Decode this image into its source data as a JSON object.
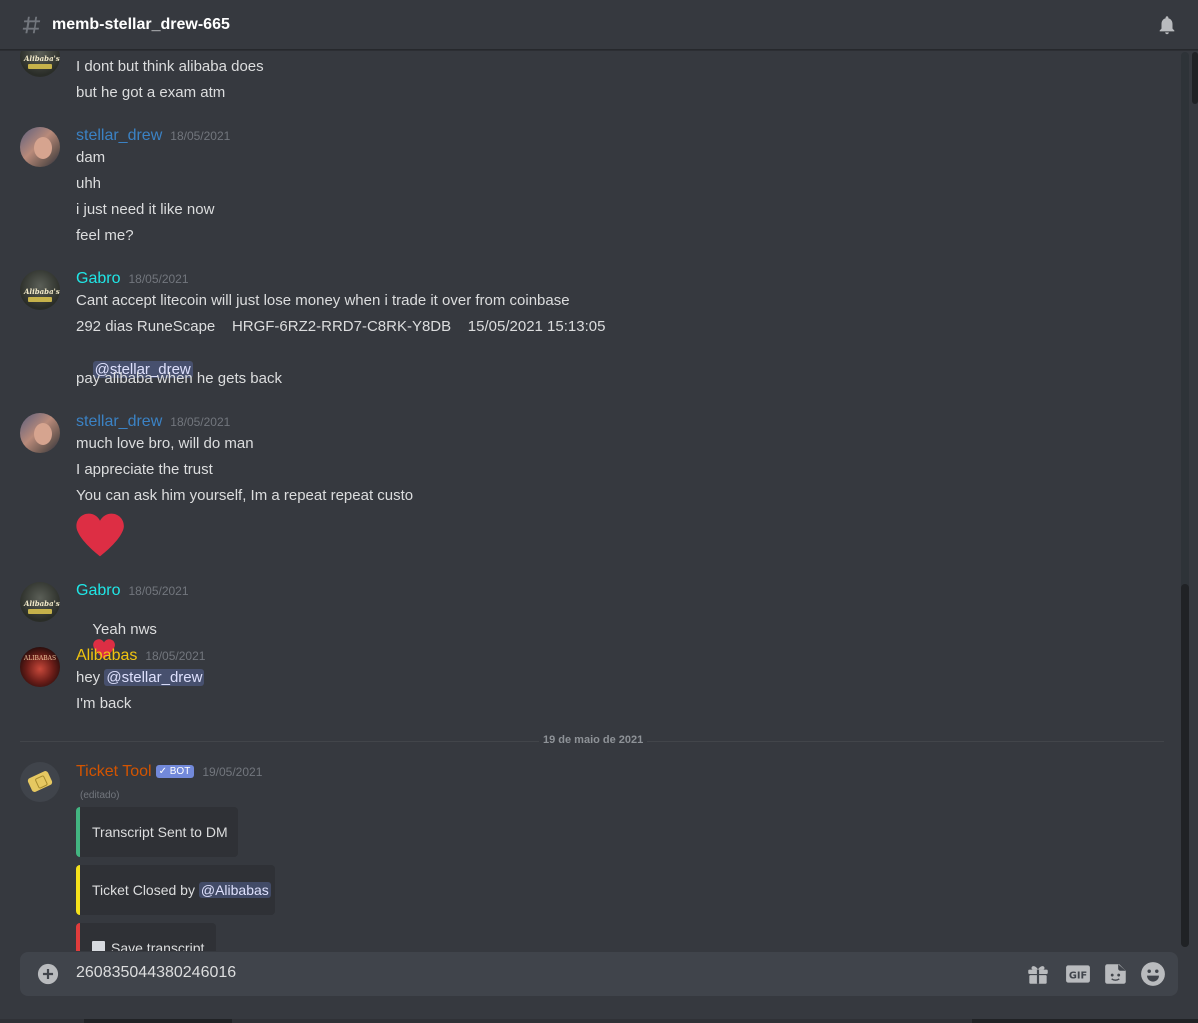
{
  "channel": {
    "name": "memb-stellar_drew-665"
  },
  "messages": {
    "top_partial": {
      "lines": [
        "I dont but think alibaba does",
        "but he got a exam atm"
      ]
    },
    "stellar1": {
      "author": "stellar_drew",
      "time": "18/05/2021",
      "lines": [
        "dam",
        "uhh",
        "i just need it like now",
        "feel me?"
      ]
    },
    "gabro1": {
      "author": "Gabro",
      "time": "18/05/2021",
      "line1": "Cant accept litecoin will just lose money when i trade it over from coinbase",
      "line2": "292 dias RuneScape    HRGF-6RZ2-RRD7-C8RK-Y8DB    15/05/2021 15:13:05",
      "mention": "@stellar_drew",
      "line4": "pay alibaba when he gets back"
    },
    "stellar2": {
      "author": "stellar_drew",
      "time": "18/05/2021",
      "lines": [
        "much love bro, will do man",
        "I appreciate the trust",
        "You can ask him yourself, Im a repeat repeat custo"
      ]
    },
    "gabro2": {
      "author": "Gabro",
      "time": "18/05/2021",
      "text": "Yeah nws"
    },
    "alibabas": {
      "author": "Alibabas",
      "time": "18/05/2021",
      "prefix": "hey",
      "mention": "@stellar_drew",
      "line2": "I'm back"
    },
    "divider": "19 de maio de 2021",
    "ticket": {
      "author": "Ticket Tool",
      "bot_label": "✓ BOT",
      "time": "19/05/2021",
      "edited": "(editado)",
      "embed1": "Transcript Sent to DM",
      "embed2_prefix": "Ticket Closed by",
      "embed2_mention": "@Alibabas",
      "embed3": "Save transcript"
    }
  },
  "composer": {
    "value": "260835044380246016"
  },
  "colors": {
    "stellar": "#3b82c4",
    "gabro": "#20e6e6",
    "alibabas": "#f1c40f",
    "ticket": "#d35400",
    "heart": "#dd2e44"
  }
}
